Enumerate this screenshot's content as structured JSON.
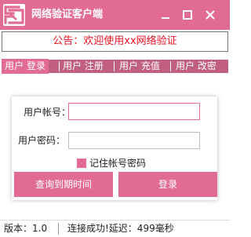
{
  "window": {
    "title": "网络验证客户端",
    "icon": "app-logo-icon",
    "controls": [
      "minimize-icon",
      "maximize-icon",
      "close-icon"
    ],
    "accent_color": "#e26b92",
    "tab_bar_color": "#c05f80"
  },
  "notice": {
    "text": "公告：欢迎使用xx网络验证",
    "color": "#ee1122"
  },
  "tabs": [
    {
      "label": "用户 登录",
      "active": true
    },
    {
      "label": "用户 注册",
      "active": false
    },
    {
      "label": "用户 充值",
      "active": false
    },
    {
      "label": "用户 改密",
      "active": false
    }
  ],
  "form": {
    "account_label": "用户帐号：",
    "account_value": "",
    "password_label": "用户密码：",
    "password_value": "",
    "remember_label": "记住帐号密码",
    "remember_checked": true
  },
  "buttons": {
    "query_expiry": "查询到期时间",
    "login": "登录"
  },
  "status": {
    "version": "版本：1.0",
    "connection": "连接成功!延迟：499毫秒"
  }
}
